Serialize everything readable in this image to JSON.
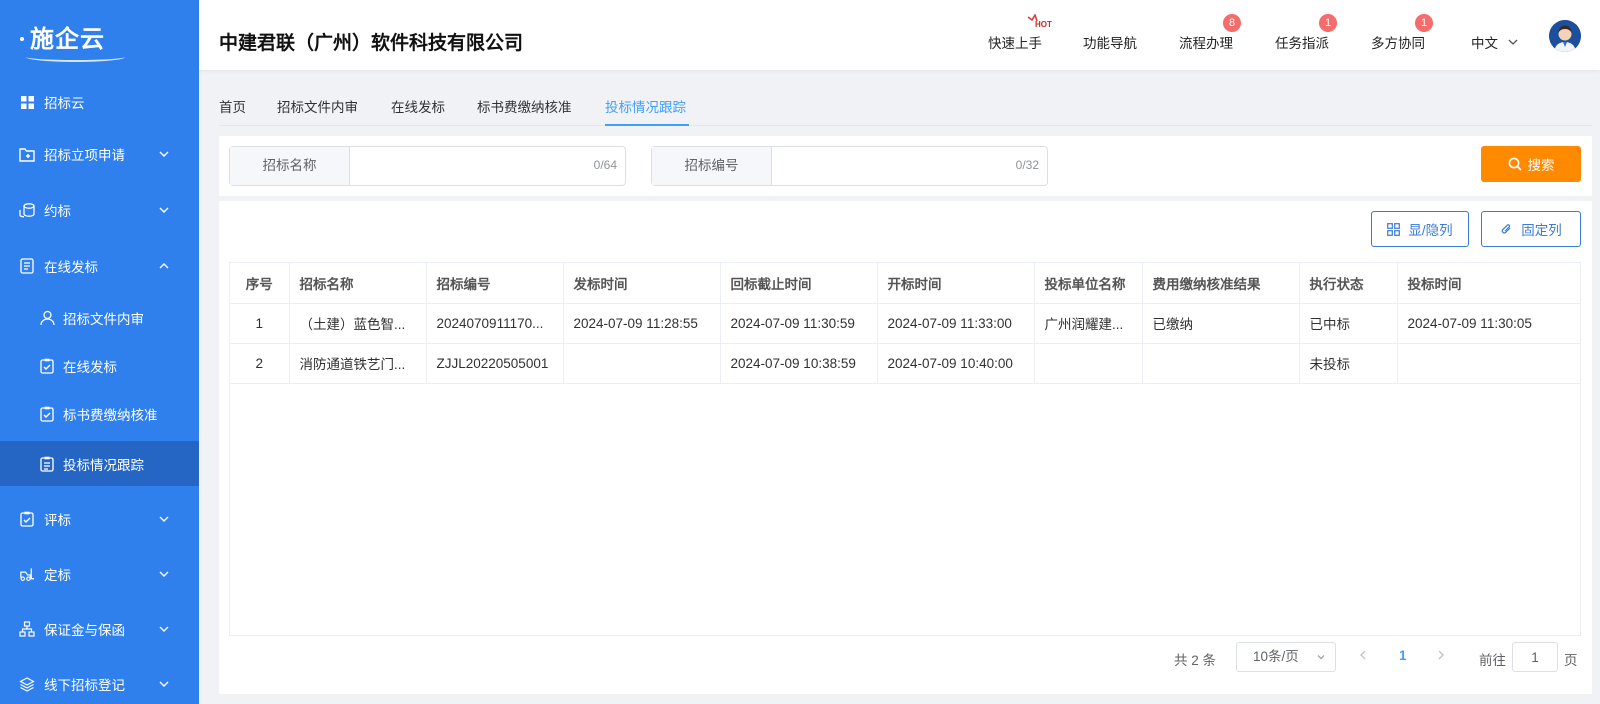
{
  "app": {
    "logo": "施企云"
  },
  "sidebar": {
    "items": [
      {
        "label": "招标云",
        "icon": "grid-icon"
      },
      {
        "label": "招标立项申请",
        "icon": "folder-icon"
      },
      {
        "label": "约标",
        "icon": "coins-icon"
      },
      {
        "label": "在线发标",
        "icon": "document-icon"
      },
      {
        "label": "评标",
        "icon": "clipboard-check-icon"
      },
      {
        "label": "定标",
        "icon": "forklift-icon"
      },
      {
        "label": "保证金与保函",
        "icon": "org-chart-icon"
      },
      {
        "label": "线下招标登记",
        "icon": "layers-icon"
      }
    ],
    "subitems": [
      {
        "label": "招标文件内审",
        "icon": "user-icon"
      },
      {
        "label": "在线发标",
        "icon": "clipboard-check-icon"
      },
      {
        "label": "标书费缴纳核准",
        "icon": "clipboard-check-icon"
      },
      {
        "label": "投标情况跟踪",
        "icon": "clipboard-list-icon",
        "active": true
      }
    ]
  },
  "header": {
    "company": "中建君联（广州）软件科技有限公司",
    "nav": [
      {
        "label": "快速上手",
        "hot": "HOT"
      },
      {
        "label": "功能导航"
      },
      {
        "label": "流程办理",
        "badge": "8"
      },
      {
        "label": "任务指派",
        "badge": "1"
      },
      {
        "label": "多方协同",
        "badge": "1"
      }
    ],
    "lang": "中文"
  },
  "tabs": [
    {
      "label": "首页"
    },
    {
      "label": "招标文件内审"
    },
    {
      "label": "在线发标"
    },
    {
      "label": "标书费缴纳核准"
    },
    {
      "label": "投标情况跟踪",
      "active": true
    }
  ],
  "search": {
    "name_label": "招标名称",
    "name_count": "0/64",
    "code_label": "招标编号",
    "code_count": "0/32",
    "button": "搜索"
  },
  "toolbar": {
    "toggle_columns": "显/隐列",
    "fixed_columns": "固定列"
  },
  "table": {
    "headers": [
      "序号",
      "招标名称",
      "招标编号",
      "发标时间",
      "回标截止时间",
      "开标时间",
      "投标单位名称",
      "费用缴纳核准结果",
      "执行状态",
      "投标时间"
    ],
    "rows": [
      [
        "1",
        "（土建）蓝色智...",
        "2024070911170...",
        "2024-07-09 11:28:55",
        "2024-07-09 11:30:59",
        "2024-07-09 11:33:00",
        "广州润耀建...",
        "已缴纳",
        "已中标",
        "2024-07-09 11:30:05"
      ],
      [
        "2",
        "消防通道铁艺门...",
        "ZJJL20220505001",
        "",
        "2024-07-09 10:38:59",
        "2024-07-09 10:40:00",
        "",
        "",
        "未投标",
        ""
      ]
    ]
  },
  "pagination": {
    "total": "共 2 条",
    "page_size": "10条/页",
    "current": "1",
    "goto_label": "前往",
    "goto_value": "1",
    "page_suffix": "页"
  },
  "colors": {
    "sidebar": "#2f80ed",
    "accent": "#409eff",
    "search_button": "#ff8a00",
    "badge": "#f56c6c"
  }
}
